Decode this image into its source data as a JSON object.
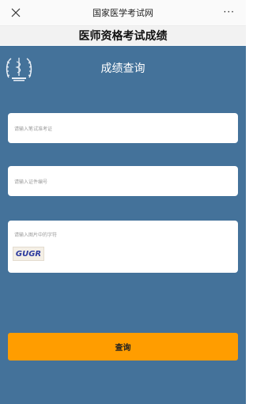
{
  "window": {
    "title": "国家医学考试网",
    "close_icon": "close-icon",
    "more_label": "···"
  },
  "header": {
    "title": "医师资格考试成绩"
  },
  "main": {
    "title": "成绩查询",
    "logo_icon": "medical-exam-logo-icon",
    "background_color": "#44729a"
  },
  "form": {
    "exam_id": {
      "placeholder": "请输入笔试准考证",
      "value": ""
    },
    "id_number": {
      "placeholder": "请输入证件编号",
      "value": ""
    },
    "captcha": {
      "placeholder": "请输入图片中的字符",
      "value": "",
      "image_text": "GUGR"
    },
    "submit_label": "查询",
    "submit_color": "#ff9d00"
  }
}
